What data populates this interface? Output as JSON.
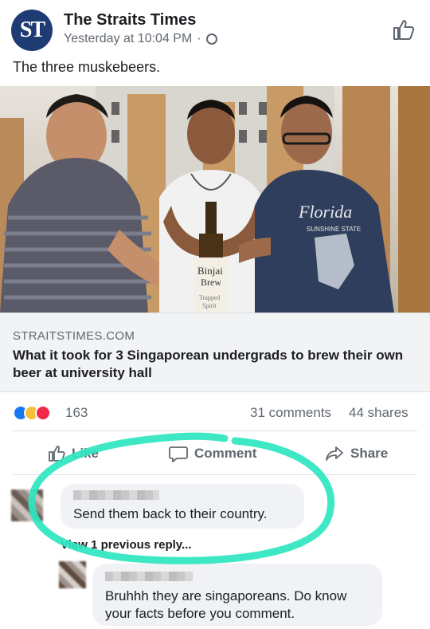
{
  "post": {
    "page_name": "The Straits Times",
    "logo_text": "ST",
    "timestamp": "Yesterday at 10:04 PM",
    "separator": "·",
    "caption": "The three muskebeers."
  },
  "link": {
    "domain": "STRAITSTIMES.COM",
    "headline": "What it took for 3 Singaporean undergrads to brew their own beer at university hall",
    "bottle_label_line1": "Binjai",
    "bottle_label_line2": "Brew",
    "bottle_label_line3": "Trapped",
    "bottle_label_line4": "Spirit",
    "shirt_text": "Florida",
    "shirt_subtext": "SUNSHINE STATE"
  },
  "stats": {
    "reaction_count": "163",
    "comments": "31 comments",
    "shares": "44 shares"
  },
  "actions": {
    "like": "Like",
    "comment": "Comment",
    "share": "Share"
  },
  "comments": [
    {
      "text": "Send them back to their country."
    },
    {
      "text": "Bruhhh they are singaporeans. Do know your facts before you comment."
    }
  ],
  "view_replies": "View 1 previous reply...",
  "colors": {
    "facebook_blue": "#1877f2",
    "annotation_circle": "#2ee6c0",
    "text_secondary": "#606770",
    "logo_navy": "#1f3b73"
  }
}
